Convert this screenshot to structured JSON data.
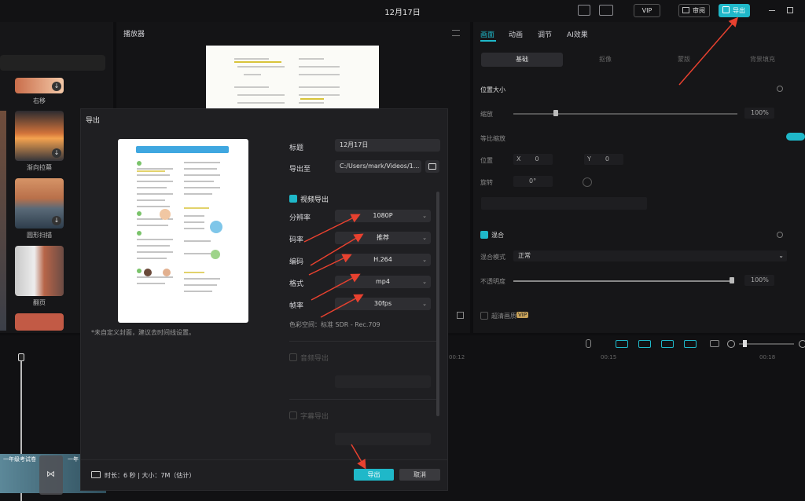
{
  "app": {
    "title": "12月17日",
    "vip_label": "VIP",
    "review_label": "审阅",
    "export_label": "导出"
  },
  "left_panel": {
    "items": [
      {
        "label": "右移"
      },
      {
        "label": "渐向拉幕"
      },
      {
        "label": "圆形扫描"
      },
      {
        "label": "翻页"
      }
    ]
  },
  "player": {
    "title": "播放器"
  },
  "right_panel": {
    "tabs": [
      "画面",
      "动画",
      "调节",
      "AI效果"
    ],
    "subtabs": [
      "基础",
      "抠像",
      "蒙版",
      "背景填充"
    ],
    "position_size_label": "位置大小",
    "scale_label": "缩放",
    "scale_value": "100%",
    "uniform_scale_label": "等比缩放",
    "position_label": "位置",
    "pos_x_label": "X",
    "pos_x_value": "0",
    "pos_y_label": "Y",
    "pos_y_value": "0",
    "rotate_label": "旋转",
    "rotate_value": "0°",
    "blend_label": "混合",
    "blend_mode_label": "混合模式",
    "blend_mode_value": "正常",
    "opacity_label": "不透明度",
    "opacity_value": "100%",
    "opacity_level": 1.0,
    "scale_level": 0.18,
    "hd_label": "超清画质",
    "hd_badge": "VIP"
  },
  "timeline": {
    "ticks": [
      "00:12",
      "00:15",
      "00:18"
    ],
    "clip_label_1": "一年级考试卷",
    "clip_label_2": "一年"
  },
  "modal": {
    "title": "导出",
    "cover_note": "*未自定义封面，建议去时间线设置。",
    "title_label": "标题",
    "title_value": "12月17日",
    "export_to_label": "导出至",
    "export_to_value": "C:/Users/mark/Videos/1...",
    "video_export_label": "视频导出",
    "fields": [
      {
        "label": "分辨率",
        "value": "1080P"
      },
      {
        "label": "码率",
        "value": "推荐"
      },
      {
        "label": "编码",
        "value": "H.264"
      },
      {
        "label": "格式",
        "value": "mp4"
      },
      {
        "label": "帧率",
        "value": "30fps"
      }
    ],
    "color_space": "色彩空间：标准 SDR - Rec.709",
    "audio_export_label": "音频导出",
    "subtitle_export_label": "字幕导出",
    "footer_info": "时长：6 秒 | 大小：7M（估计）",
    "export_button": "导出",
    "cancel_button": "取消"
  },
  "colors": {
    "accent": "#1fb8c9",
    "annotation_arrow": "#e8412f"
  }
}
